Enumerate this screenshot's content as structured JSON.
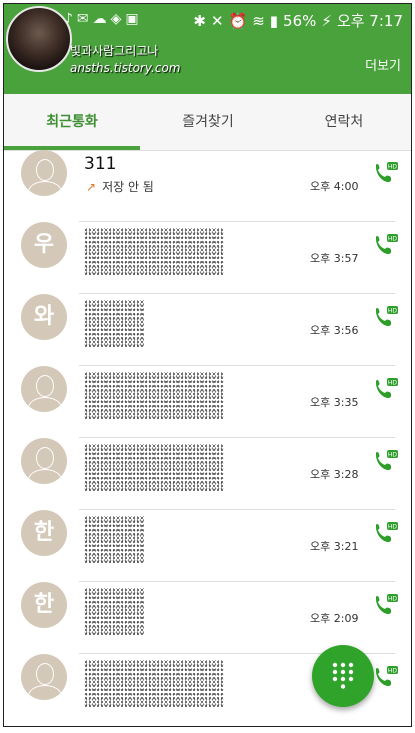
{
  "status_bar": {
    "battery": "56%",
    "clock": "오후 7:17"
  },
  "app_bar": {
    "watermark_line1": "빛과사람그리고나",
    "watermark_line2": "ansths.tistory.com",
    "more_label": "더보기"
  },
  "tabs": [
    {
      "label": "최근통화",
      "active": true
    },
    {
      "label": "즐겨찾기",
      "active": false
    },
    {
      "label": "연락처",
      "active": false
    }
  ],
  "calls": [
    {
      "name": "311",
      "sub": "저장 안 됨",
      "time": "오후 4:00",
      "avatar": "person-icon",
      "initial": ""
    },
    {
      "name": "",
      "sub": "",
      "time": "오후 3:57",
      "avatar": "initial",
      "initial": "우"
    },
    {
      "name": "",
      "sub": "",
      "time": "오후 3:56",
      "avatar": "initial",
      "initial": "와"
    },
    {
      "name": "",
      "sub": "",
      "time": "오후 3:35",
      "avatar": "person-icon",
      "initial": ""
    },
    {
      "name": "",
      "sub": "",
      "time": "오후 3:28",
      "avatar": "person-icon",
      "initial": ""
    },
    {
      "name": "",
      "sub": "",
      "time": "오후 3:21",
      "avatar": "initial",
      "initial": "한"
    },
    {
      "name": "",
      "sub": "",
      "time": "오후 2:09",
      "avatar": "initial",
      "initial": "한"
    },
    {
      "name": "",
      "sub": "",
      "time": "",
      "avatar": "person-icon",
      "initial": ""
    }
  ],
  "colors": {
    "brand_green": "#4aa23d",
    "fab_green": "#2fa32a",
    "call_green": "#2e9e2a"
  }
}
